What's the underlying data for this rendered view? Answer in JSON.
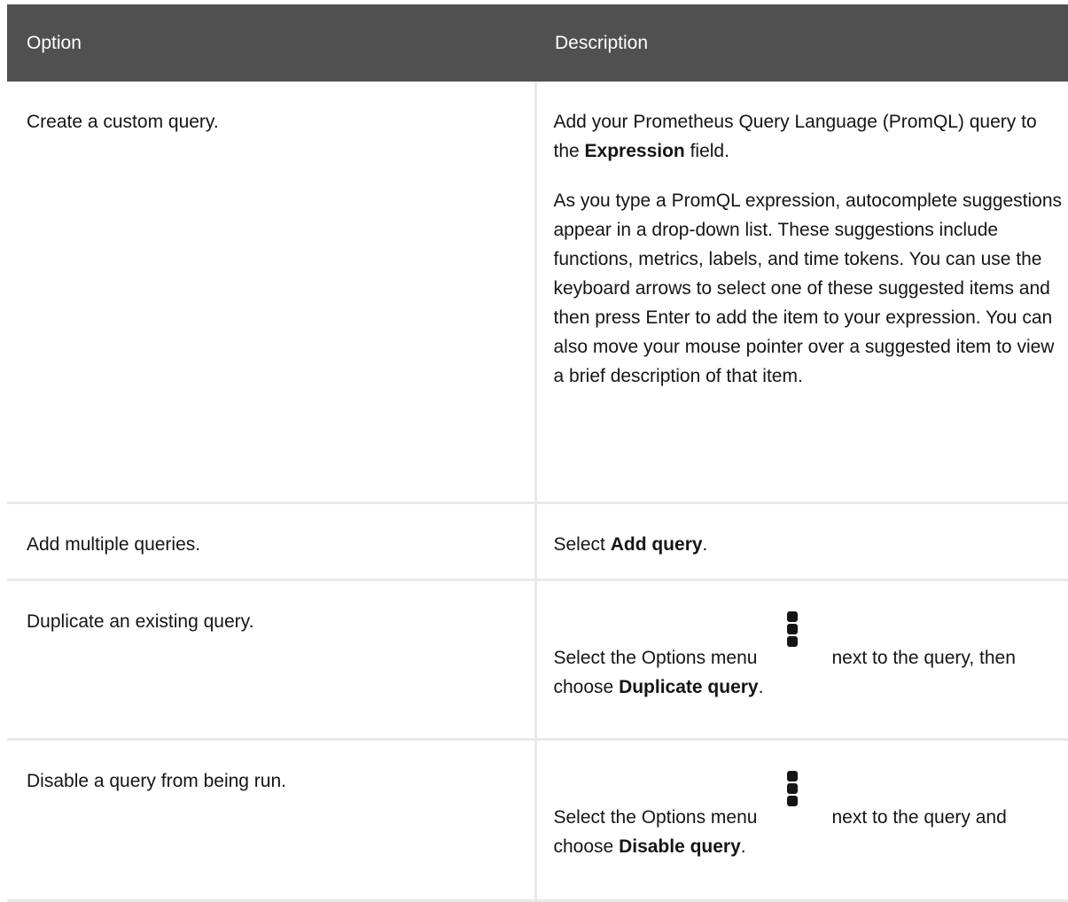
{
  "table": {
    "headers": {
      "option": "Option",
      "description": "Description"
    },
    "rows": [
      {
        "option": "Create a custom query.",
        "desc_p1_a": "Add your Prometheus Query Language (PromQL) query to the ",
        "desc_p1_b": "Expression",
        "desc_p1_c": " field.",
        "desc_p2": "As you type a PromQL expression, autocomplete suggestions appear in a drop-down list. These suggestions include functions, metrics, labels, and time tokens. You can use the keyboard arrows to select one of these suggested items and then press Enter to add the item to your expression. You can also move your mouse pointer over a suggested item to view a brief description of that item."
      },
      {
        "option": "Add multiple queries.",
        "desc_a": "Select ",
        "desc_b": "Add query",
        "desc_c": "."
      },
      {
        "option": "Duplicate an existing query.",
        "desc_a": "Select the Options menu",
        "icon": "kebab-menu-icon",
        "desc_b": "next to the query, then choose ",
        "desc_c": "Duplicate query",
        "desc_d": "."
      },
      {
        "option": "Disable a query from being run.",
        "desc_a": "Select the Options menu",
        "icon": "kebab-menu-icon",
        "desc_b": "next to the query and choose ",
        "desc_c": "Disable query",
        "desc_d": "."
      }
    ]
  }
}
